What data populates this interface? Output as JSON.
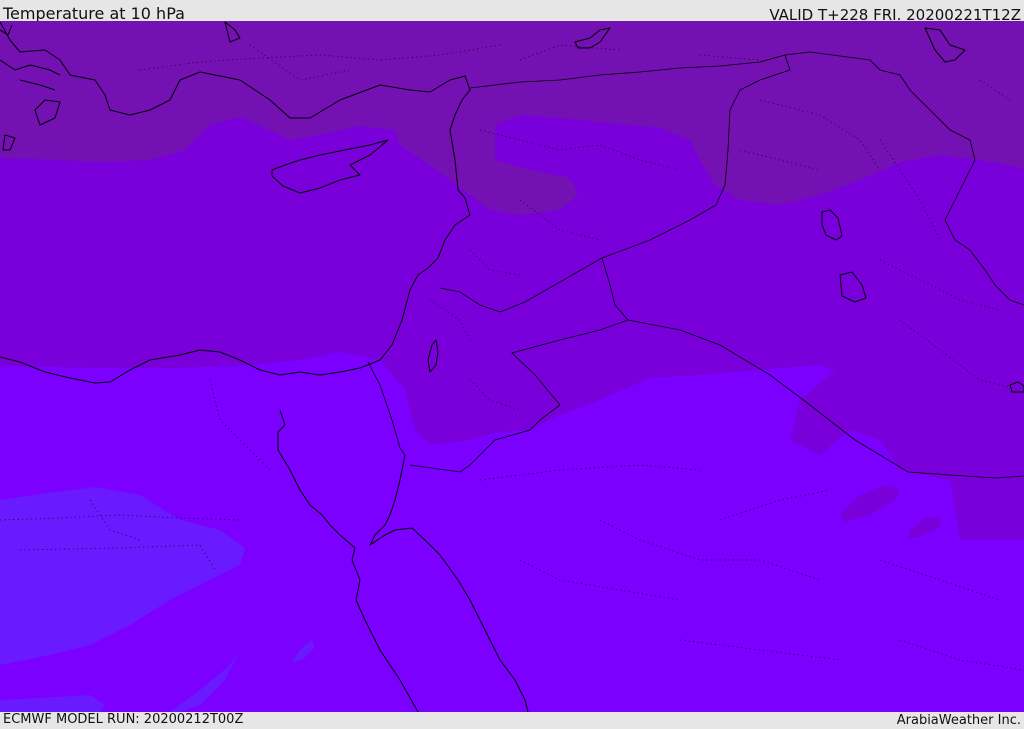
{
  "header": {
    "title": "Temperature at 10 hPa",
    "valid": "VALID T+228 FRI. 20200221T12Z"
  },
  "footer": {
    "model_run": "ECMWF MODEL RUN: 20200212T00Z",
    "brand": "ArabiaWeather Inc."
  },
  "colors": {
    "band_coldest": "#7411b2",
    "band_cold": "#7900db",
    "band_mid": "#7b00ff",
    "band_warm": "#6a1aff",
    "coast": "#000000"
  }
}
